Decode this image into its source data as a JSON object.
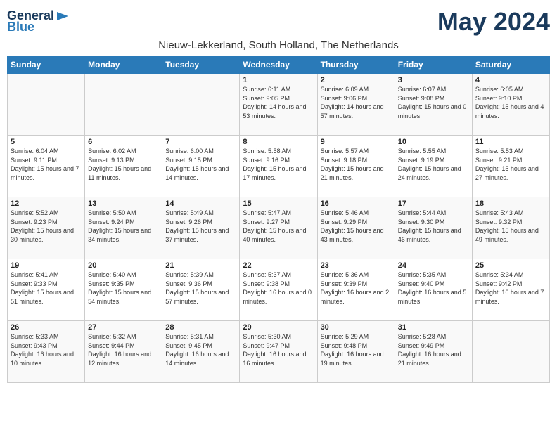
{
  "header": {
    "logo_line1": "General",
    "logo_line2": "Blue",
    "title": "May 2024",
    "subtitle": "Nieuw-Lekkerland, South Holland, The Netherlands"
  },
  "weekdays": [
    "Sunday",
    "Monday",
    "Tuesday",
    "Wednesday",
    "Thursday",
    "Friday",
    "Saturday"
  ],
  "weeks": [
    [
      {
        "day": "",
        "info": ""
      },
      {
        "day": "",
        "info": ""
      },
      {
        "day": "",
        "info": ""
      },
      {
        "day": "1",
        "info": "Sunrise: 6:11 AM\nSunset: 9:05 PM\nDaylight: 14 hours and 53 minutes."
      },
      {
        "day": "2",
        "info": "Sunrise: 6:09 AM\nSunset: 9:06 PM\nDaylight: 14 hours and 57 minutes."
      },
      {
        "day": "3",
        "info": "Sunrise: 6:07 AM\nSunset: 9:08 PM\nDaylight: 15 hours and 0 minutes."
      },
      {
        "day": "4",
        "info": "Sunrise: 6:05 AM\nSunset: 9:10 PM\nDaylight: 15 hours and 4 minutes."
      }
    ],
    [
      {
        "day": "5",
        "info": "Sunrise: 6:04 AM\nSunset: 9:11 PM\nDaylight: 15 hours and 7 minutes."
      },
      {
        "day": "6",
        "info": "Sunrise: 6:02 AM\nSunset: 9:13 PM\nDaylight: 15 hours and 11 minutes."
      },
      {
        "day": "7",
        "info": "Sunrise: 6:00 AM\nSunset: 9:15 PM\nDaylight: 15 hours and 14 minutes."
      },
      {
        "day": "8",
        "info": "Sunrise: 5:58 AM\nSunset: 9:16 PM\nDaylight: 15 hours and 17 minutes."
      },
      {
        "day": "9",
        "info": "Sunrise: 5:57 AM\nSunset: 9:18 PM\nDaylight: 15 hours and 21 minutes."
      },
      {
        "day": "10",
        "info": "Sunrise: 5:55 AM\nSunset: 9:19 PM\nDaylight: 15 hours and 24 minutes."
      },
      {
        "day": "11",
        "info": "Sunrise: 5:53 AM\nSunset: 9:21 PM\nDaylight: 15 hours and 27 minutes."
      }
    ],
    [
      {
        "day": "12",
        "info": "Sunrise: 5:52 AM\nSunset: 9:23 PM\nDaylight: 15 hours and 30 minutes."
      },
      {
        "day": "13",
        "info": "Sunrise: 5:50 AM\nSunset: 9:24 PM\nDaylight: 15 hours and 34 minutes."
      },
      {
        "day": "14",
        "info": "Sunrise: 5:49 AM\nSunset: 9:26 PM\nDaylight: 15 hours and 37 minutes."
      },
      {
        "day": "15",
        "info": "Sunrise: 5:47 AM\nSunset: 9:27 PM\nDaylight: 15 hours and 40 minutes."
      },
      {
        "day": "16",
        "info": "Sunrise: 5:46 AM\nSunset: 9:29 PM\nDaylight: 15 hours and 43 minutes."
      },
      {
        "day": "17",
        "info": "Sunrise: 5:44 AM\nSunset: 9:30 PM\nDaylight: 15 hours and 46 minutes."
      },
      {
        "day": "18",
        "info": "Sunrise: 5:43 AM\nSunset: 9:32 PM\nDaylight: 15 hours and 49 minutes."
      }
    ],
    [
      {
        "day": "19",
        "info": "Sunrise: 5:41 AM\nSunset: 9:33 PM\nDaylight: 15 hours and 51 minutes."
      },
      {
        "day": "20",
        "info": "Sunrise: 5:40 AM\nSunset: 9:35 PM\nDaylight: 15 hours and 54 minutes."
      },
      {
        "day": "21",
        "info": "Sunrise: 5:39 AM\nSunset: 9:36 PM\nDaylight: 15 hours and 57 minutes."
      },
      {
        "day": "22",
        "info": "Sunrise: 5:37 AM\nSunset: 9:38 PM\nDaylight: 16 hours and 0 minutes."
      },
      {
        "day": "23",
        "info": "Sunrise: 5:36 AM\nSunset: 9:39 PM\nDaylight: 16 hours and 2 minutes."
      },
      {
        "day": "24",
        "info": "Sunrise: 5:35 AM\nSunset: 9:40 PM\nDaylight: 16 hours and 5 minutes."
      },
      {
        "day": "25",
        "info": "Sunrise: 5:34 AM\nSunset: 9:42 PM\nDaylight: 16 hours and 7 minutes."
      }
    ],
    [
      {
        "day": "26",
        "info": "Sunrise: 5:33 AM\nSunset: 9:43 PM\nDaylight: 16 hours and 10 minutes."
      },
      {
        "day": "27",
        "info": "Sunrise: 5:32 AM\nSunset: 9:44 PM\nDaylight: 16 hours and 12 minutes."
      },
      {
        "day": "28",
        "info": "Sunrise: 5:31 AM\nSunset: 9:45 PM\nDaylight: 16 hours and 14 minutes."
      },
      {
        "day": "29",
        "info": "Sunrise: 5:30 AM\nSunset: 9:47 PM\nDaylight: 16 hours and 16 minutes."
      },
      {
        "day": "30",
        "info": "Sunrise: 5:29 AM\nSunset: 9:48 PM\nDaylight: 16 hours and 19 minutes."
      },
      {
        "day": "31",
        "info": "Sunrise: 5:28 AM\nSunset: 9:49 PM\nDaylight: 16 hours and 21 minutes."
      },
      {
        "day": "",
        "info": ""
      }
    ]
  ]
}
